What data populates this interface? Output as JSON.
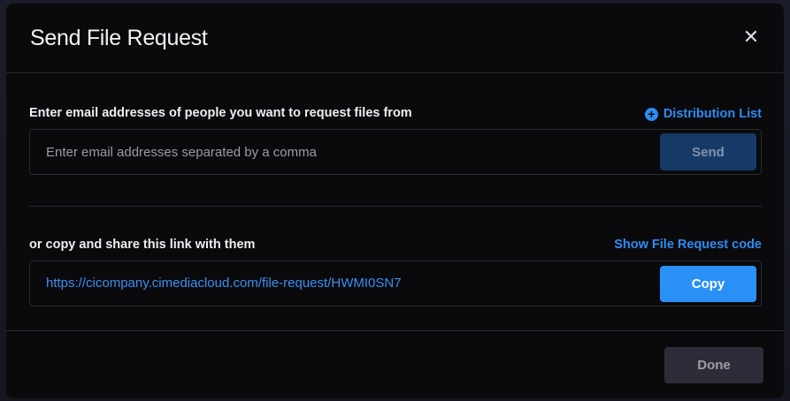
{
  "modal": {
    "title": "Send File Request",
    "close_icon": "close-icon"
  },
  "request_section": {
    "label": "Enter email addresses of people you want to request files from",
    "distribution_list_label": "Distribution List",
    "distribution_list_icon": "plus-circle-icon",
    "email_input": {
      "value": "",
      "placeholder": "Enter email addresses separated by a comma"
    },
    "send_label": "Send"
  },
  "share_section": {
    "label": "or copy and share this link with them",
    "show_code_label": "Show File Request code",
    "link_url": "https://cicompany.cimediacloud.com/file-request/HWMI0SN7",
    "copy_label": "Copy"
  },
  "footer": {
    "done_label": "Done"
  },
  "colors": {
    "accent": "#2b90f5",
    "background": "#0a0a0d",
    "send_disabled": "#163a67",
    "done_button": "#2c2d38"
  }
}
